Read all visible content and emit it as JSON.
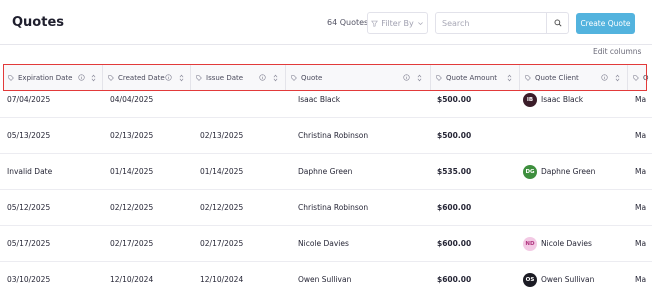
{
  "header": {
    "title": "Quotes",
    "count": "64 Quotes",
    "filter_label": "Filter By",
    "search_placeholder": "Search",
    "create_label": "Create Quote",
    "edit_columns_label": "Edit columns"
  },
  "columns": [
    {
      "label": "Expiration Date"
    },
    {
      "label": "Created Date"
    },
    {
      "label": "Issue Date"
    },
    {
      "label": "Quote"
    },
    {
      "label": "Quote Amount"
    },
    {
      "label": "Quote Client"
    },
    {
      "label": "Q"
    }
  ],
  "rows": [
    {
      "expiration": "07/04/2025",
      "created": "04/04/2025",
      "issue": "",
      "quote": "Isaac Black",
      "amount": "$500.00",
      "client": {
        "name": "Isaac Black",
        "initials": "IB",
        "bg": "#3b1d2a",
        "fg": "#ffffff"
      },
      "extra": "Ma"
    },
    {
      "expiration": "05/13/2025",
      "created": "02/13/2025",
      "issue": "02/13/2025",
      "quote": "Christina Robinson",
      "amount": "$500.00",
      "client": {
        "name": "",
        "initials": "",
        "bg": "",
        "fg": ""
      },
      "extra": "Ma"
    },
    {
      "expiration": "Invalid Date",
      "created": "01/14/2025",
      "issue": "01/14/2025",
      "quote": "Daphne Green",
      "amount": "$535.00",
      "client": {
        "name": "Daphne Green",
        "initials": "DG",
        "bg": "#3e8f3e",
        "fg": "#ffffff"
      },
      "extra": "Ma"
    },
    {
      "expiration": "05/12/2025",
      "created": "02/12/2025",
      "issue": "02/12/2025",
      "quote": "Christina Robinson",
      "amount": "$600.00",
      "client": {
        "name": "",
        "initials": "",
        "bg": "",
        "fg": ""
      },
      "extra": "Ma"
    },
    {
      "expiration": "05/17/2025",
      "created": "02/17/2025",
      "issue": "02/17/2025",
      "quote": "Nicole Davies",
      "amount": "$600.00",
      "client": {
        "name": "Nicole Davies",
        "initials": "ND",
        "bg": "#f3c9e4",
        "fg": "#b0357f"
      },
      "extra": "Ma"
    },
    {
      "expiration": "03/10/2025",
      "created": "12/10/2024",
      "issue": "12/10/2024",
      "quote": "Owen Sullivan",
      "amount": "$600.00",
      "client": {
        "name": "Owen Sullivan",
        "initials": "OS",
        "bg": "#1c1c24",
        "fg": "#ffffff"
      },
      "extra": "Ma"
    }
  ],
  "icons": {
    "filter": "funnel-icon",
    "chevron": "chevron-down-icon",
    "search": "search-icon",
    "column_tag": "tag-icon",
    "info": "info-icon",
    "sort": "sort-icon"
  },
  "colors": {
    "accent": "#53b3de",
    "highlight_border": "#e23a3a"
  }
}
